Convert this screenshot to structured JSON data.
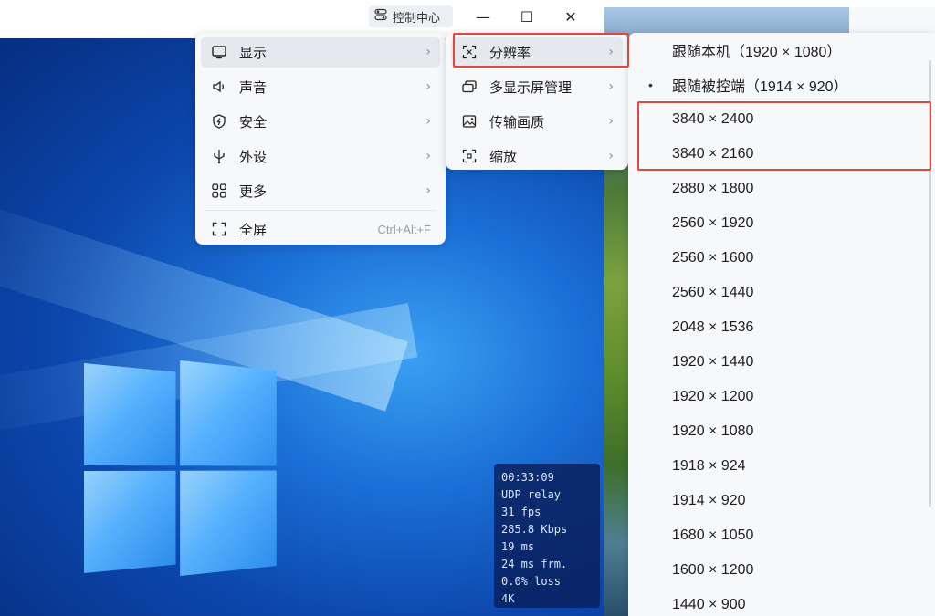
{
  "titlebar": {
    "control_center_label": "控制中心",
    "minimize_glyph": "—",
    "maximize_glyph": "☐",
    "close_glyph": "✕"
  },
  "main_menu": {
    "items": [
      {
        "label": "显示",
        "icon": "monitor-icon"
      },
      {
        "label": "声音",
        "icon": "speaker-icon"
      },
      {
        "label": "安全",
        "icon": "shield-icon"
      },
      {
        "label": "外设",
        "icon": "usb-icon"
      },
      {
        "label": "更多",
        "icon": "grid-icon"
      }
    ],
    "fullscreen_label": "全屏",
    "fullscreen_shortcut": "Ctrl+Alt+F"
  },
  "display_menu": {
    "items": [
      {
        "label": "分辨率",
        "icon": "resolution-icon"
      },
      {
        "label": "多显示屏管理",
        "icon": "multi-monitor-icon"
      },
      {
        "label": "传输画质",
        "icon": "image-quality-icon"
      },
      {
        "label": "缩放",
        "icon": "zoom-icon"
      }
    ]
  },
  "resolution_menu": {
    "items": [
      {
        "label": "跟随本机（1920 × 1080）",
        "selected": false
      },
      {
        "label": "跟随被控端（1914 × 920）",
        "selected": true
      },
      {
        "label": "3840 × 2400",
        "selected": false
      },
      {
        "label": "3840 × 2160",
        "selected": false
      },
      {
        "label": "2880 × 1800",
        "selected": false
      },
      {
        "label": "2560 × 1920",
        "selected": false
      },
      {
        "label": "2560 × 1600",
        "selected": false
      },
      {
        "label": "2560 × 1440",
        "selected": false
      },
      {
        "label": "2048 × 1536",
        "selected": false
      },
      {
        "label": "1920 × 1440",
        "selected": false
      },
      {
        "label": "1920 × 1200",
        "selected": false
      },
      {
        "label": "1920 × 1080",
        "selected": false
      },
      {
        "label": "1918 × 924",
        "selected": false
      },
      {
        "label": "1914 × 920",
        "selected": false
      },
      {
        "label": "1680 × 1050",
        "selected": false
      },
      {
        "label": "1600 × 1200",
        "selected": false
      },
      {
        "label": "1440 × 900",
        "selected": false
      }
    ],
    "selected_marker": "•"
  },
  "stats_overlay": {
    "lines": [
      "00:33:09",
      "UDP relay",
      "31 fps",
      "285.8 Kbps",
      "19 ms",
      "24 ms frm.",
      "0.0% loss",
      "4K"
    ]
  },
  "colors": {
    "highlight_box": "#e1483d",
    "menu_bg": "#f7f8fa",
    "active_item_bg": "#e5e8ec"
  }
}
